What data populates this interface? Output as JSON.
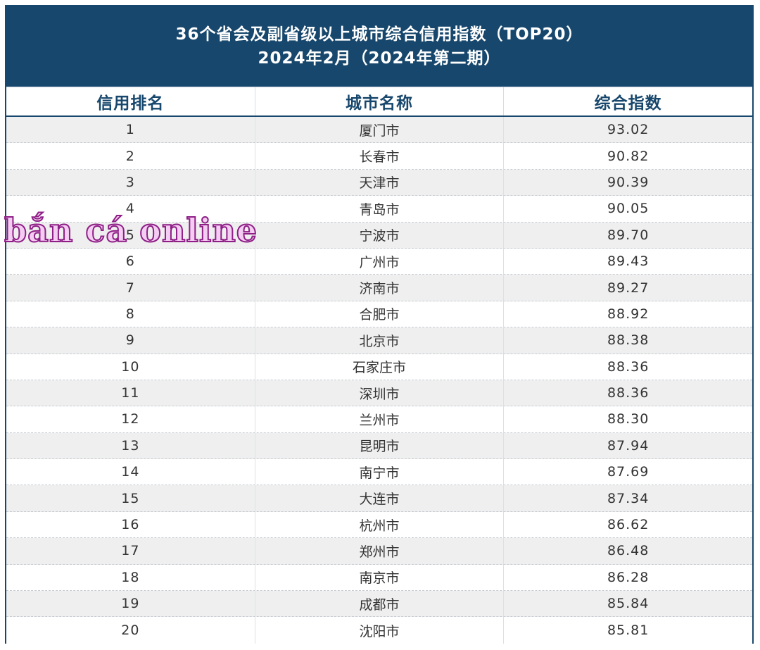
{
  "title": {
    "line1": "36个省会及副省级以上城市综合信用指数（TOP20）",
    "line2": "2024年2月（2024年第二期）"
  },
  "headers": [
    "信用排名",
    "城市名称",
    "综合指数"
  ],
  "watermark": "bắn cá online",
  "colors": {
    "header_bg": "#17476c",
    "stripe": "#efefef",
    "header_text": "#17476c"
  },
  "chart_data": {
    "type": "table",
    "columns": [
      "信用排名",
      "城市名称",
      "综合指数"
    ],
    "rows": [
      [
        "1",
        "厦门市",
        "93.02"
      ],
      [
        "2",
        "长春市",
        "90.82"
      ],
      [
        "3",
        "天津市",
        "90.39"
      ],
      [
        "4",
        "青岛市",
        "90.05"
      ],
      [
        "5",
        "宁波市",
        "89.70"
      ],
      [
        "6",
        "广州市",
        "89.43"
      ],
      [
        "7",
        "济南市",
        "89.27"
      ],
      [
        "8",
        "合肥市",
        "88.92"
      ],
      [
        "9",
        "北京市",
        "88.38"
      ],
      [
        "10",
        "石家庄市",
        "88.36"
      ],
      [
        "11",
        "深圳市",
        "88.36"
      ],
      [
        "12",
        "兰州市",
        "88.30"
      ],
      [
        "13",
        "昆明市",
        "87.94"
      ],
      [
        "14",
        "南宁市",
        "87.69"
      ],
      [
        "15",
        "大连市",
        "87.34"
      ],
      [
        "16",
        "杭州市",
        "86.62"
      ],
      [
        "17",
        "郑州市",
        "86.48"
      ],
      [
        "18",
        "南京市",
        "86.28"
      ],
      [
        "19",
        "成都市",
        "85.84"
      ],
      [
        "20",
        "沈阳市",
        "85.81"
      ]
    ]
  }
}
